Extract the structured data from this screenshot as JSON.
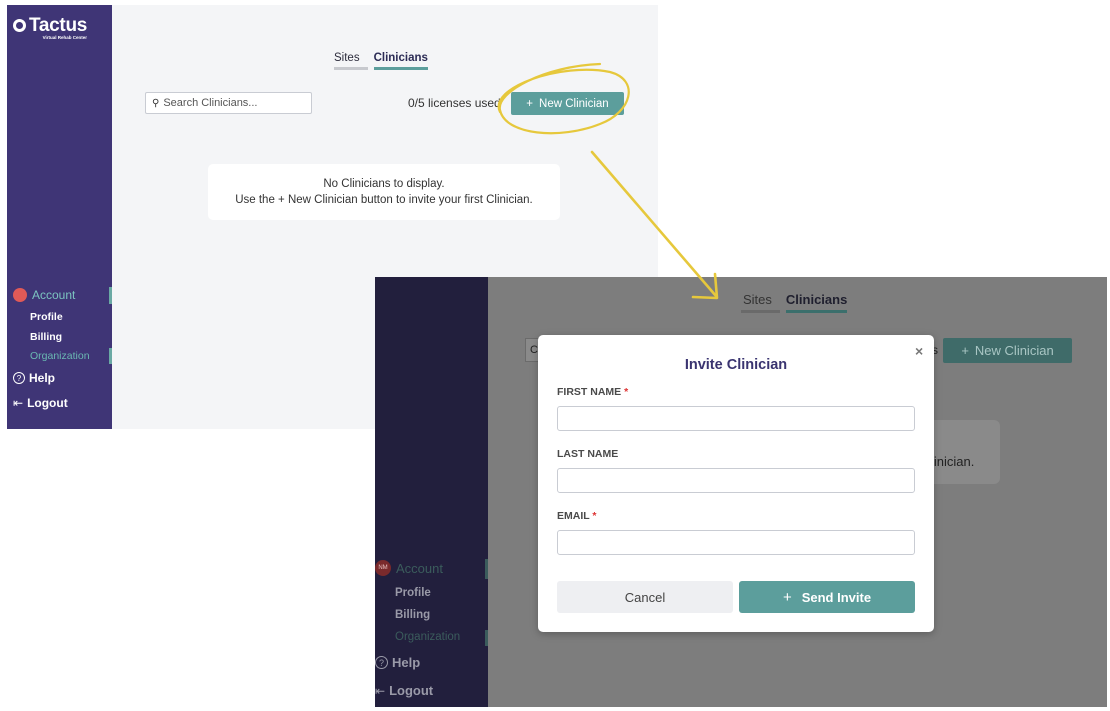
{
  "brand": {
    "name": "Tactus",
    "tagline": "Virtual Rehab Center"
  },
  "screen1": {
    "tabs": [
      {
        "label": "Sites",
        "active": false
      },
      {
        "label": "Clinicians",
        "active": true
      }
    ],
    "search_placeholder": "Search Clinicians...",
    "licenses": "0/5 licenses used",
    "new_button": "New Clinician",
    "empty_line1": "No Clinicians to display.",
    "empty_line2": "Use the + New Clinician button to invite your first Clinician.",
    "nav": {
      "account": "Account",
      "profile": "Profile",
      "billing": "Billing",
      "organization": "Organization",
      "help": "Help",
      "logout": "Logout"
    }
  },
  "screen2": {
    "tabs": [
      {
        "label": "Sites",
        "active": false
      },
      {
        "label": "Clinicians",
        "active": true
      }
    ],
    "new_button": "New Clinician",
    "bg_partial_letter": "C",
    "bg_partial_s": "s",
    "bg_partial_clinician": "linician.",
    "avatar_initials": "NM",
    "nav": {
      "account": "Account",
      "profile": "Profile",
      "billing": "Billing",
      "organization": "Organization",
      "help": "Help",
      "logout": "Logout"
    },
    "modal": {
      "title": "Invite Clinician",
      "close": "×",
      "first_name_label": "FIRST NAME",
      "last_name_label": "LAST NAME",
      "email_label": "EMAIL",
      "required_mark": "*",
      "first_name_value": "",
      "last_name_value": "",
      "email_value": "",
      "cancel": "Cancel",
      "send": "Send Invite"
    }
  },
  "icons": {
    "search": "⚲",
    "plus": "+",
    "help": "?",
    "logout": "⇤"
  },
  "colors": {
    "sidebar": "#3f3576",
    "sidebar_dim": "#221f3d",
    "accent_teal": "#5c9e9c",
    "annotation_yellow": "#e6c83c",
    "account_dot": "#e05a57"
  }
}
